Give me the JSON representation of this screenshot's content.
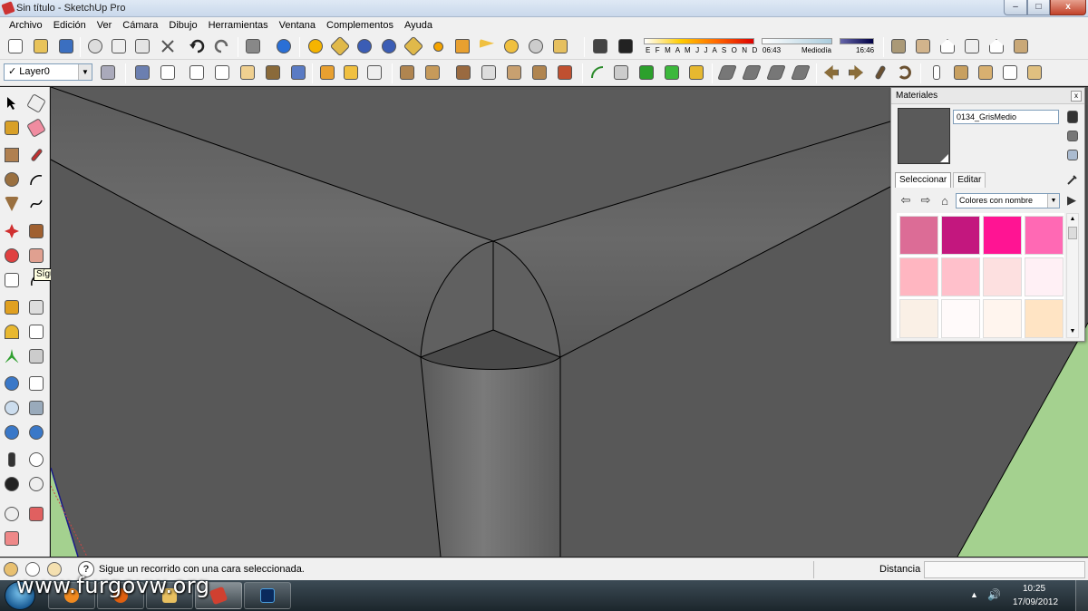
{
  "window": {
    "title": "Sin título - SketchUp Pro",
    "minimize": "–",
    "maximize": "□",
    "close": "x"
  },
  "menu": [
    "Archivo",
    "Edición",
    "Ver",
    "Cámara",
    "Dibujo",
    "Herramientas",
    "Ventana",
    "Complementos",
    "Ayuda"
  ],
  "layer": {
    "current": "Layer0",
    "check": "✓"
  },
  "shadows": {
    "months": "E F M A M J J A S O N D",
    "time_start": "06:43",
    "mid_label": "Mediodía",
    "time_end": "16:46"
  },
  "tooltip": "Sígueme",
  "materials": {
    "title": "Materiales",
    "material_name": "0134_GrisMedio",
    "tab_select": "Seleccionar",
    "tab_edit": "Editar",
    "collection": "Colores con nombre",
    "swatches": [
      "#dc6c96",
      "#c3177e",
      "#ff1493",
      "#ff69b4",
      "#ffb6c1",
      "#ffc0cb",
      "#fde0e0",
      "#fff0f5",
      "#faf0e6",
      "#fffafa",
      "#fff5ee",
      "#ffe4c4"
    ]
  },
  "status": {
    "message": "Sigue un recorrido con una cara seleccionada.",
    "distance_label": "Distancia",
    "help": "?"
  },
  "taskbar": {
    "watermark": "www.furgovw.org",
    "time": "10:25",
    "date": "17/09/2012",
    "tray_arrow": "▲",
    "volume": "🔊"
  }
}
